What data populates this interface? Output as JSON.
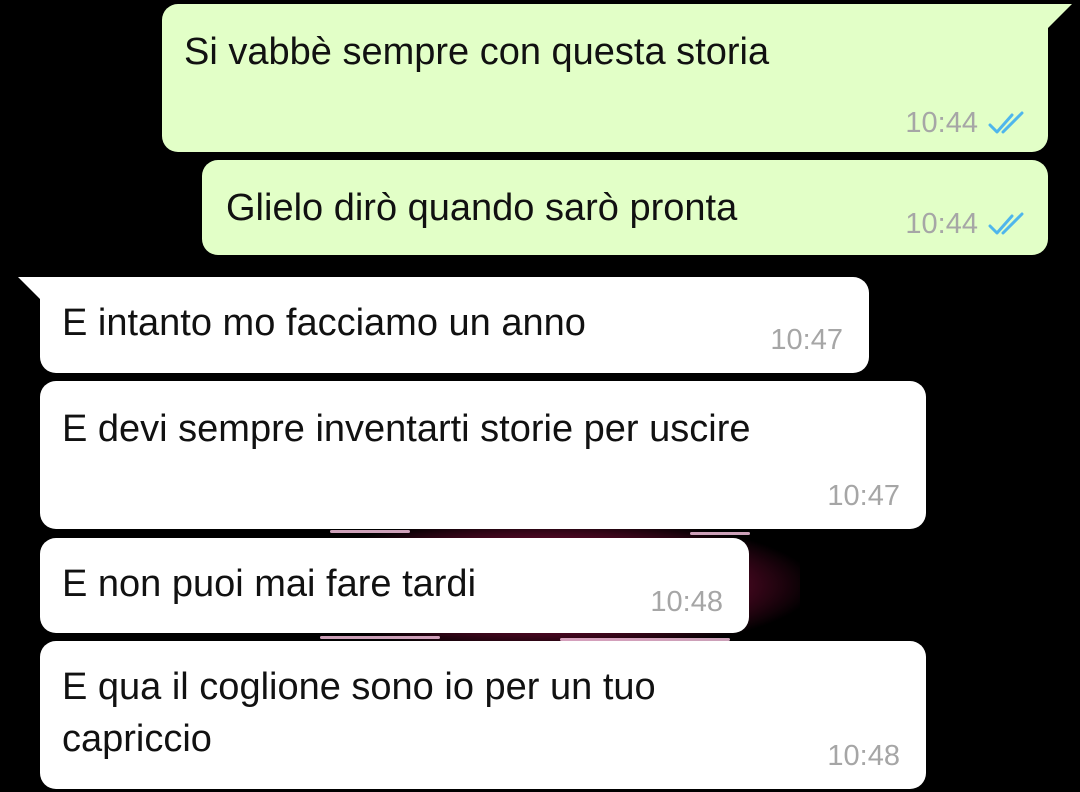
{
  "colors": {
    "background": "#000000",
    "outgoing_bubble": "#e2ffc7",
    "incoming_bubble": "#ffffff",
    "timestamp": "#a6a6a6",
    "read_ticks": "#4fb6ec"
  },
  "messages": [
    {
      "direction": "outgoing",
      "text": "Si vabbè sempre con questa storia",
      "time": "10:44",
      "status_icon": "double-check-read-icon"
    },
    {
      "direction": "outgoing",
      "text": "Glielo dirò quando sarò pronta",
      "time": "10:44",
      "status_icon": "double-check-read-icon"
    },
    {
      "direction": "incoming",
      "text": "E intanto mo facciamo un anno",
      "time": "10:47"
    },
    {
      "direction": "incoming",
      "text": "E devi sempre inventarti storie per uscire",
      "time": "10:47"
    },
    {
      "direction": "incoming",
      "text": "E non puoi mai fare tardi",
      "time": "10:48"
    },
    {
      "direction": "incoming",
      "text": "E qua il coglione sono io per un tuo capriccio",
      "time": "10:48"
    }
  ]
}
